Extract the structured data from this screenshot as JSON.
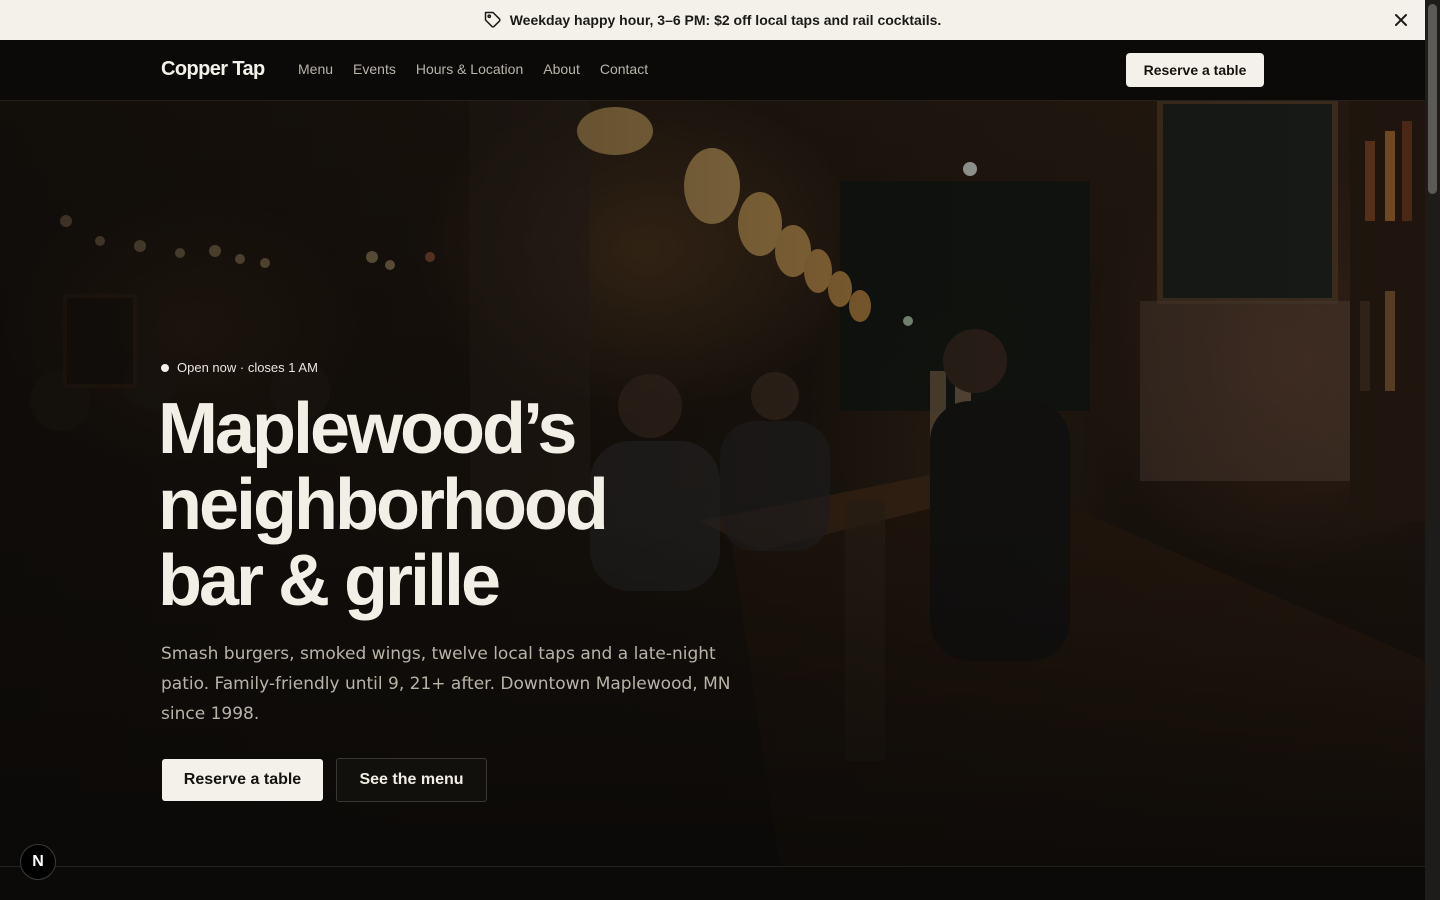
{
  "announcement": {
    "text": "Weekday happy hour, 3–6 PM: $2 off local taps and rail cocktails.",
    "icon": "tag-icon",
    "close_icon": "close-icon"
  },
  "nav": {
    "brand": "Copper Tap",
    "links": [
      "Menu",
      "Events",
      "Hours & Location",
      "About",
      "Contact"
    ],
    "cta": "Reserve a table"
  },
  "hero": {
    "status": "Open now · closes 1 AM",
    "headline": [
      "Maplewood’s",
      "neighborhood",
      "bar & grille"
    ],
    "subtext": "Smash burgers, smoked wings, twelve local taps and a late-night patio. Family-friendly until 9, 21+ after. Downtown Maplewood, MN since 1998.",
    "primary_button": "Reserve a table",
    "secondary_button": "See the menu",
    "background_image": "bar interior with pendant lights and taps"
  },
  "dev_badge": {
    "label": "N"
  },
  "colors": {
    "announcement_bg": "#f3f1ea",
    "nav_bg": "#0b0a09",
    "button_light": "#f3f1ea",
    "text_light": "#f2efe6"
  }
}
